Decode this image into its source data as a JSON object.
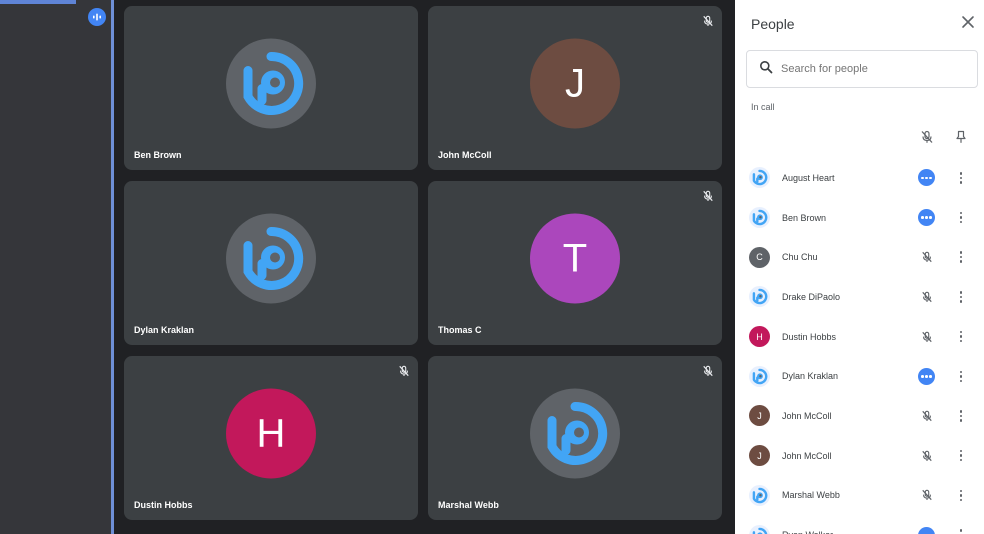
{
  "grid": {
    "tiles": [
      {
        "name": "Ben Brown",
        "avatar_type": "logo",
        "muted": false
      },
      {
        "name": "John McColl",
        "avatar_type": "letter",
        "letter": "J",
        "color": "#6d4c41",
        "muted": true
      },
      {
        "name": "Dylan Kraklan",
        "avatar_type": "logo",
        "muted": false
      },
      {
        "name": "Thomas C",
        "avatar_type": "letter",
        "letter": "T",
        "color": "#ab47bc",
        "muted": true
      },
      {
        "name": "Dustin Hobbs",
        "avatar_type": "letter",
        "letter": "H",
        "color": "#c2185b",
        "muted": true
      },
      {
        "name": "Marshal Webb",
        "avatar_type": "logo",
        "muted": true
      }
    ]
  },
  "panel": {
    "title": "People",
    "search_placeholder": "Search for people",
    "section_label": "In call",
    "participants": [
      {
        "name": "August Heart",
        "avatar_type": "logo",
        "status": "talking"
      },
      {
        "name": "Ben Brown",
        "avatar_type": "logo",
        "status": "talking"
      },
      {
        "name": "Chu Chu",
        "avatar_type": "letter",
        "letter": "C",
        "color": "#5f6368",
        "status": "muted"
      },
      {
        "name": "Drake DiPaolo",
        "avatar_type": "logo",
        "status": "muted"
      },
      {
        "name": "Dustin Hobbs",
        "avatar_type": "letter",
        "letter": "H",
        "color": "#c2185b",
        "status": "muted"
      },
      {
        "name": "Dylan Kraklan",
        "avatar_type": "logo",
        "status": "talking"
      },
      {
        "name": "John McColl",
        "avatar_type": "letter",
        "letter": "J",
        "color": "#6d4c41",
        "status": "muted"
      },
      {
        "name": "John McColl",
        "avatar_type": "letter",
        "letter": "J",
        "color": "#6d4c41",
        "status": "muted"
      },
      {
        "name": "Marshal Webb",
        "avatar_type": "logo",
        "status": "muted"
      },
      {
        "name": "Ryan Walker",
        "avatar_type": "logo",
        "status": "talking"
      }
    ]
  },
  "colors": {
    "accent": "#4285f4",
    "logo_blue": "#42a5f5",
    "tile_bg": "#3c4043"
  },
  "icons": {
    "speaking": "audio-bars-icon",
    "muted": "mic-off-icon",
    "pin": "pin-icon",
    "close": "close-icon",
    "search": "search-icon",
    "more": "more-vert-icon"
  }
}
